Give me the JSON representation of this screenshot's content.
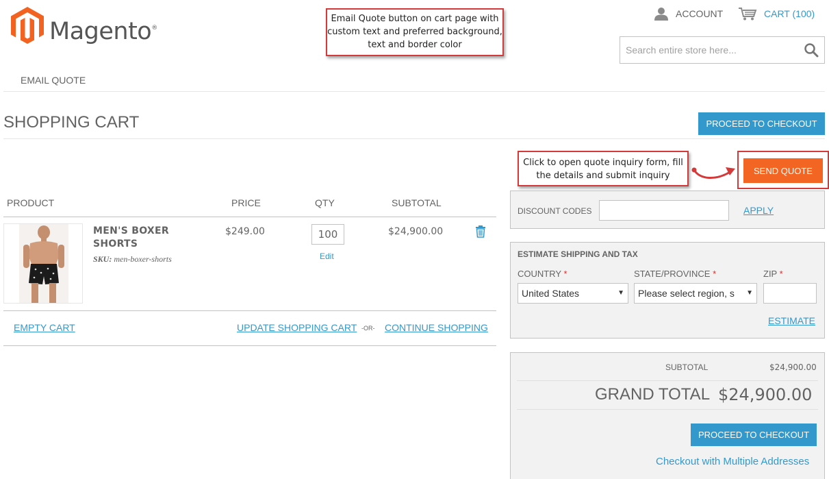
{
  "brand": {
    "name": "Magento",
    "trademark": "®",
    "logo_color": "#f26322"
  },
  "header": {
    "account_label": "ACCOUNT",
    "cart_label": "CART (100)",
    "search_placeholder": "Search entire store here..."
  },
  "nav": {
    "email_quote": "EMAIL QUOTE"
  },
  "annotations": {
    "top": "Email Quote button on cart page with custom text and preferred background, text and border color",
    "side": "Click to open quote inquiry form, fill the details and submit inquiry"
  },
  "page": {
    "title": "SHOPPING CART",
    "proceed_checkout": "PROCEED TO CHECKOUT",
    "send_quote": "SEND QUOTE"
  },
  "cart": {
    "columns": [
      "PRODUCT",
      "PRICE",
      "QTY",
      "SUBTOTAL"
    ],
    "item": {
      "name": "MEN'S BOXER SHORTS",
      "sku_label": "SKU:",
      "sku": "men-boxer-shorts",
      "price": "$249.00",
      "qty": "100",
      "edit": "Edit",
      "subtotal": "$24,900.00"
    },
    "actions": {
      "empty": "EMPTY CART",
      "update": "UPDATE SHOPPING CART",
      "or": "-OR-",
      "continue": "CONTINUE SHOPPING"
    }
  },
  "discount": {
    "label": "DISCOUNT CODES",
    "apply": "APPLY"
  },
  "shipping": {
    "title": "ESTIMATE SHIPPING AND TAX",
    "country_label": "COUNTRY",
    "state_label": "STATE/PROVINCE",
    "zip_label": "ZIP",
    "required_mark": "*",
    "country_value": "United States",
    "state_value": "Please select region, s",
    "estimate": "ESTIMATE"
  },
  "totals": {
    "subtotal_label": "SUBTOTAL",
    "subtotal_value": "$24,900.00",
    "grand_label": "GRAND TOTAL",
    "grand_value": "$24,900.00",
    "checkout": "PROCEED TO CHECKOUT",
    "multi_address": "Checkout with Multiple Addresses"
  },
  "colors": {
    "accent_blue": "#3399cc",
    "quote_orange": "#f36523",
    "callout_red": "#d43a3a"
  }
}
